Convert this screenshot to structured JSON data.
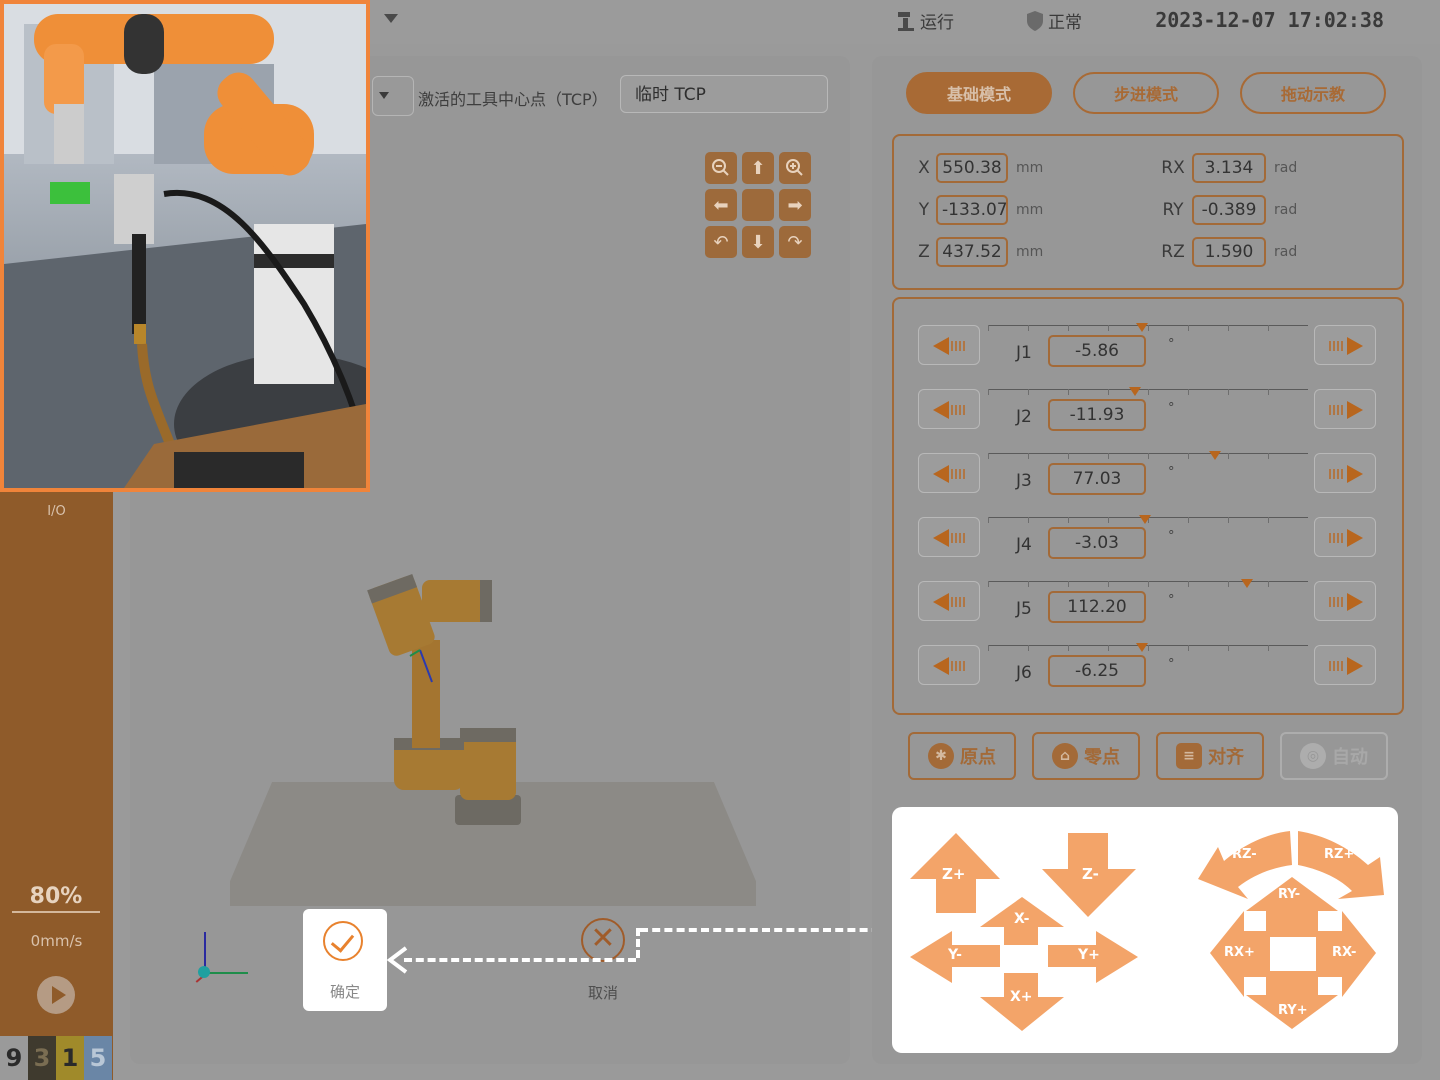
{
  "topbar": {
    "run_status": "运行",
    "safety_status": "正常",
    "datetime": "2023-12-07 17:02:38"
  },
  "sidebar": {
    "io_label": "I/O",
    "speed_percent": "80%",
    "speed_value": "0mm/s",
    "digits": [
      {
        "text": "9",
        "bg": "#9a9a9a",
        "fg": "#2a2a2a"
      },
      {
        "text": "3",
        "bg": "#3f3a2e",
        "fg": "#7a6d52"
      },
      {
        "text": "1",
        "bg": "#a08a2a",
        "fg": "#2a2a2a"
      },
      {
        "text": "5",
        "bg": "#6a86a6",
        "fg": "#b9c7d6"
      }
    ]
  },
  "tcp": {
    "label": "激活的工具中心点（TCP）",
    "value": "临时 TCP"
  },
  "dialog": {
    "confirm_label": "确定",
    "cancel_label": "取消"
  },
  "modes": [
    {
      "label": "基础模式",
      "active": true
    },
    {
      "label": "步进模式",
      "active": false
    },
    {
      "label": "拖动示教",
      "active": false
    }
  ],
  "pose": {
    "x": {
      "label": "X",
      "value": "550.38",
      "unit": "mm"
    },
    "y": {
      "label": "Y",
      "value": "-133.07",
      "unit": "mm"
    },
    "z": {
      "label": "Z",
      "value": "437.52",
      "unit": "mm"
    },
    "rx": {
      "label": "RX",
      "value": "3.134",
      "unit": "rad"
    },
    "ry": {
      "label": "RY",
      "value": "-0.389",
      "unit": "rad"
    },
    "rz": {
      "label": "RZ",
      "value": "1.590",
      "unit": "rad"
    }
  },
  "joints": [
    {
      "name": "J1",
      "value": "-5.86",
      "unit": "°",
      "slider": 0.48
    },
    {
      "name": "J2",
      "value": "-11.93",
      "unit": "°",
      "slider": 0.46
    },
    {
      "name": "J3",
      "value": "77.03",
      "unit": "°",
      "slider": 0.71
    },
    {
      "name": "J4",
      "value": "-3.03",
      "unit": "°",
      "slider": 0.49
    },
    {
      "name": "J5",
      "value": "112.20",
      "unit": "°",
      "slider": 0.81
    },
    {
      "name": "J6",
      "value": "-6.25",
      "unit": "°",
      "slider": 0.48
    }
  ],
  "actions": {
    "home": "原点",
    "zero": "零点",
    "align": "对齐",
    "auto": "自动"
  },
  "jog": {
    "zplus": "Z+",
    "zminus": "Z-",
    "xminus": "X-",
    "xplus": "X+",
    "yminus": "Y-",
    "yplus": "Y+",
    "rzminus": "RZ-",
    "rzplus": "RZ+",
    "ryminus": "RY-",
    "ryplus": "RY+",
    "rxplus": "RX+",
    "rxminus": "RX-"
  },
  "colors": {
    "accent": "#a86a35",
    "jog_arrow": "#f3a469",
    "highlight": "#f0843a"
  }
}
